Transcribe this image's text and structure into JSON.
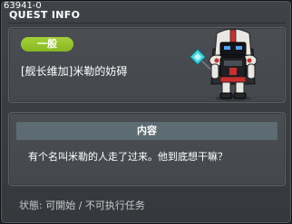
{
  "window": {
    "quest_id": "63941-0",
    "title": "QUEST INFO"
  },
  "quest": {
    "category": "一般",
    "name": "[舰长维加]米勒的妨碍"
  },
  "details": {
    "header": "内容",
    "description": "有个名叫米勒的人走了过来。他到底想干嘛？"
  },
  "status": {
    "text": "状態: 可開始 / 不可执行任务"
  },
  "colors": {
    "badge": "#93c42b",
    "section_header": "#5d6b72",
    "panel": "#474b50",
    "window": "#3a3d41"
  },
  "icons": {
    "npc": "robot-knight-npc-icon"
  }
}
